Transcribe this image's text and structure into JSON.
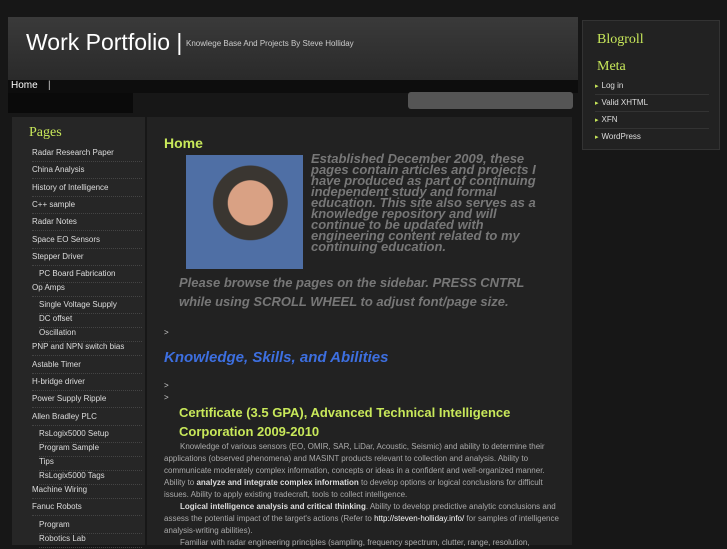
{
  "header": {
    "title": "Work Portfolio |",
    "tagline": "Knowlege Base And Projects By Steve Holliday"
  },
  "nav": {
    "home": "Home",
    "sep": "|"
  },
  "right": {
    "blogroll": "Blogroll",
    "meta": "Meta",
    "links": [
      "Log in",
      "Valid XHTML",
      "XFN",
      "WordPress"
    ]
  },
  "sidebar": {
    "heading": "Pages",
    "items": [
      {
        "label": "Radar Research Paper",
        "sub": false
      },
      {
        "label": "China Analysis",
        "sub": false
      },
      {
        "label": "History of Intelligence",
        "sub": false
      },
      {
        "label": "C++ sample",
        "sub": false
      },
      {
        "label": "Radar Notes",
        "sub": false
      },
      {
        "label": "Space EO Sensors",
        "sub": false
      },
      {
        "label": "Stepper Driver",
        "sub": false
      },
      {
        "label": "PC Board Fabrication",
        "sub": true
      },
      {
        "label": "Op Amps",
        "sub": false
      },
      {
        "label": "Single Voltage Supply",
        "sub": true
      },
      {
        "label": "DC offset",
        "sub": true
      },
      {
        "label": "Oscillation",
        "sub": true
      },
      {
        "label": "PNP and NPN switch bias",
        "sub": false
      },
      {
        "label": "Astable Timer",
        "sub": false
      },
      {
        "label": "H-bridge driver",
        "sub": false
      },
      {
        "label": "Power Supply Ripple",
        "sub": false
      },
      {
        "label": "Allen Bradley PLC",
        "sub": false
      },
      {
        "label": "RsLogix5000 Setup",
        "sub": true
      },
      {
        "label": "Program Sample",
        "sub": true
      },
      {
        "label": "Tips",
        "sub": true
      },
      {
        "label": "RsLogix5000 Tags",
        "sub": true
      },
      {
        "label": "Machine Wiring",
        "sub": false
      },
      {
        "label": "Fanuc Robots",
        "sub": false
      },
      {
        "label": "Program",
        "sub": true
      },
      {
        "label": "Robotics Lab",
        "sub": true
      }
    ]
  },
  "content": {
    "home": "Home",
    "intro": "Established December 2009, these pages contain articles and projects I have produced as part of continuing independent study and formal education.  This site also serves as a knowledge repository and will continue to be updated with engineering content related to my continuing education.",
    "intro2": "Please browse the pages on the sidebar.  PRESS CNTRL while using SCROLL WHEEL to adjust font/page size.",
    "gt": ">",
    "ksa": "Knowledge, Skills, and Abilities",
    "cert": "Certificate (3.5 GPA), Advanced Technical Intelligence Corporation 2009-2010",
    "p1": "Knowledge of various sensors (EO, OMIR, SAR, LiDar, Acoustic, Seismic) and ability to determine their applications (observed phenomena) and MASINT products relevant to collection and analysis. Ability to communicate moderately complex information, concepts or ideas in a confident and well-organized manner. Ability to",
    "p1_bold": "analyze and integrate complex information",
    "p1_tail": "to develop options or logical conclusions for difficult issues.  Ability to apply existing tradecraft, tools to collect intelligence.",
    "p2_bold": "Logical intelligence analysis and critical thinking",
    "p2": ".  Ability to develop predictive analytic conclusions and assess the potential impact of the target's actions (Refer to",
    "p2_link": "http://steven-holliday.info/",
    "p2_tail": "for samples of intelligence analysis-writing abilities).",
    "p3": "Familiar with radar engineering principles (sampling, frequency spectrum, clutter, range, resolution,"
  }
}
